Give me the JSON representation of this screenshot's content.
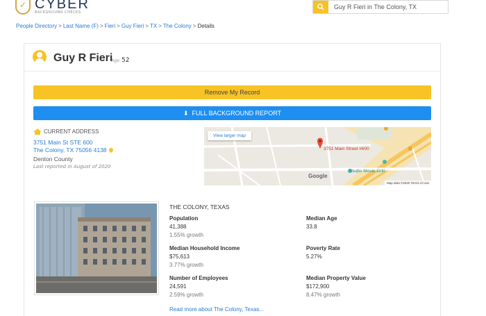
{
  "header": {
    "logo_title": "CYBER",
    "logo_sub": "BACKGROUND CHECKS",
    "search_value": "Guy R Fieri in The Colony, TX"
  },
  "breadcrumb": [
    "People Directory",
    "Last Name (F)",
    "Fieri",
    "Guy Fieri",
    "TX",
    "The Colony",
    "Details"
  ],
  "person": {
    "name": "Guy R Fieri",
    "age_label": "Age:",
    "age": "52"
  },
  "buttons": {
    "remove": "Remove My Record",
    "report": "FULL BACKGROUND REPORT"
  },
  "address": {
    "heading": "CURRENT ADDRESS",
    "line1": "3751 Main St STE 600",
    "line2": "The Colony, TX 75056 4138",
    "county": "Denton County",
    "reported": "Last reported in August of 2020"
  },
  "map": {
    "view_larger": "View larger map",
    "pin_label": "3751 Main Street #600",
    "poi_label": "Studio Movie Grill",
    "google": "Google",
    "footer": "Map data ©2020   Terms of Use"
  },
  "city": {
    "title": "THE COLONY, TEXAS",
    "stats": [
      {
        "label": "Population",
        "value": "41,388",
        "growth": "1.55% growth"
      },
      {
        "label": "Median Age",
        "value": "33.8",
        "growth": ""
      },
      {
        "label": "Median Household Income",
        "value": "$75,613",
        "growth": "3.77% growth"
      },
      {
        "label": "Poverty Rate",
        "value": "5.27%",
        "growth": ""
      },
      {
        "label": "Number of Employees",
        "value": "24,591",
        "growth": "2.59% growth"
      },
      {
        "label": "Median Property Value",
        "value": "$172,900",
        "growth": "8.47% growth"
      }
    ],
    "read_more": "Read more about The Colony, Texas..."
  },
  "colors": {
    "accent_yellow": "#f7c325",
    "accent_blue": "#1f8ef1",
    "link_blue": "#2a7bd0"
  }
}
